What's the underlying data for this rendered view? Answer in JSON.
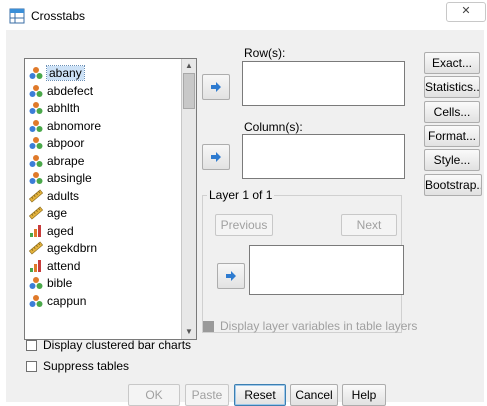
{
  "window": {
    "title": "Crosstabs",
    "close_label": "✕"
  },
  "variables": [
    {
      "name": "abany",
      "type": "nominal",
      "selected": true
    },
    {
      "name": "abdefect",
      "type": "nominal"
    },
    {
      "name": "abhlth",
      "type": "nominal"
    },
    {
      "name": "abnomore",
      "type": "nominal"
    },
    {
      "name": "abpoor",
      "type": "nominal"
    },
    {
      "name": "abrape",
      "type": "nominal"
    },
    {
      "name": "absingle",
      "type": "nominal"
    },
    {
      "name": "adults",
      "type": "scale"
    },
    {
      "name": "age",
      "type": "scale"
    },
    {
      "name": "aged",
      "type": "ordinal"
    },
    {
      "name": "agekdbrn",
      "type": "scale"
    },
    {
      "name": "attend",
      "type": "ordinal"
    },
    {
      "name": "bible",
      "type": "nominal"
    },
    {
      "name": "cappun",
      "type": "nominal"
    }
  ],
  "fields": {
    "rows_label": "Row(s):",
    "columns_label": "Column(s):",
    "layer_label": "Layer 1 of 1",
    "previous_label": "Previous",
    "next_label": "Next"
  },
  "side_buttons": {
    "exact": "Exact...",
    "statistics": "Statistics...",
    "cells": "Cells...",
    "format": "Format...",
    "style": "Style...",
    "bootstrap": "Bootstrap..."
  },
  "options": {
    "display_layer_vars": "Display layer variables in table layers",
    "clustered_bar": "Display clustered bar charts",
    "suppress_tables": "Suppress tables"
  },
  "bottom_buttons": {
    "ok": "OK",
    "paste": "Paste",
    "reset": "Reset",
    "cancel": "Cancel",
    "help": "Help"
  },
  "colors": {
    "dialog_bg": "#f0f0f0",
    "selection": "#cde2f7",
    "arrow_blue": "#2e7bd0"
  }
}
